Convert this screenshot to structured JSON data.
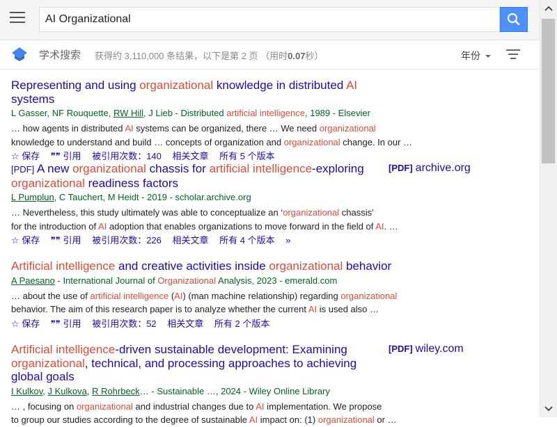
{
  "search": {
    "query": "AI Organizational"
  },
  "subbar": {
    "brand": "学术搜索",
    "stats_prefix": "获得约 3,110,000 条结果，以下是第 2 页 （用时",
    "stats_time": "0.07",
    "stats_suffix": "秒）",
    "year_filter": "年份"
  },
  "actions_common": {
    "save": "保存",
    "cite": "引用",
    "related": "相关文章"
  },
  "results": [
    {
      "title_parts": [
        "Representing and using ",
        "organizational",
        " knowledge in distributed ",
        "AI",
        " systems"
      ],
      "authors_parts": [
        "L Gasser, NF Rouquette, ",
        "RW Hill",
        ", J Lieb - Distributed ",
        "artificial intelligence",
        ", 1989 - Elsevier"
      ],
      "snippet1_parts": [
        "… how agents in distributed ",
        "AI",
        " systems can be organized, there … We need ",
        "organizational"
      ],
      "snippet2_parts": [
        "knowledge to understand and build … concepts of organization and ",
        "organizational",
        " change. In our …"
      ],
      "cited": "被引用次数：140",
      "versions": "所有 5 个版本"
    },
    {
      "tag": "[PDF]",
      "title_parts": [
        " A new ",
        "organizational",
        " chassis for ",
        "artificial intelligence",
        "-exploring "
      ],
      "title2_parts": [
        "organizational",
        " readiness factors"
      ],
      "authors_parts": [
        "L Pumplun",
        ", C Tauchert, M Heidt - 2019 - scholar.archive.org"
      ],
      "snippet1_parts": [
        "… Nevertheless, this study ultimately was able to conceptualize an ‘",
        "organizational",
        " chassis’"
      ],
      "snippet2_parts": [
        "for the introduction of ",
        "AI",
        " adoption that enables organizations to move forward in the field of ",
        "AI",
        ". …"
      ],
      "cited": "被引用次数：226",
      "versions": "所有 4 个版本",
      "side_pdf": "[PDF]",
      "side_domain": "archive.org"
    },
    {
      "title_parts": [
        "Artificial intelligence",
        " and creative activities inside ",
        "organizational",
        " behavior"
      ],
      "authors_parts": [
        "A Paesano",
        " - International Journal of ",
        "Organizational",
        " Analysis, 2023 - emerald.com"
      ],
      "snippet1_parts": [
        "… about the use of ",
        "artificial intelligence",
        " (",
        "AI",
        ") (man machine relationship) regarding ",
        "organizational"
      ],
      "snippet2_parts": [
        "behavior. The aim of this research paper is to analyze whether the current ",
        "AI",
        " is used also …"
      ],
      "cited": "被引用次数：52",
      "versions": "所有 2 个版本"
    },
    {
      "title_parts": [
        "Artificial intelligence",
        "-driven sustainable development: Examining"
      ],
      "title2_parts": [
        "organizational",
        ", technical, and processing approaches to achieving"
      ],
      "title3": "global goals",
      "authors_parts": [
        "I Kulkov",
        ", ",
        "J Kulkova",
        ", ",
        "R Rohrbeck",
        "… - Sustainable …, 2024 - Wiley Online Library"
      ],
      "snippet1_parts": [
        "… , focusing on ",
        "organizational",
        " and industrial changes due to ",
        "AI",
        " implementation. We propose"
      ],
      "snippet2_parts": [
        "to group our studies according to the degree of sustainable ",
        "AI",
        " impact on: (1) ",
        "organizational",
        " or …"
      ],
      "side_pdf": "[PDF]",
      "side_domain": "wiley.com"
    }
  ]
}
